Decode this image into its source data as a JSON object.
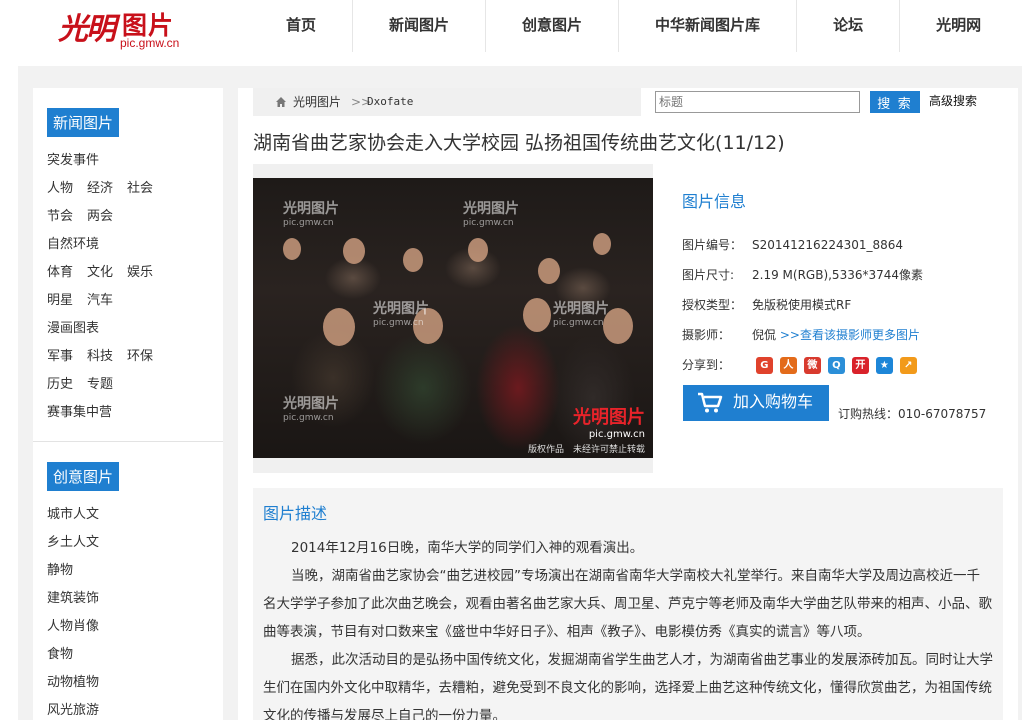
{
  "header": {
    "logo_mark": "光明",
    "logo_text": "图片",
    "logo_url": "pic.gmw.cn",
    "nav": [
      "首页",
      "新闻图片",
      "创意图片",
      "中华新闻图片库",
      "论坛",
      "光明网"
    ]
  },
  "sidebar": {
    "news_title": "新闻图片",
    "news_rows": [
      [
        "突发事件"
      ],
      [
        "人物",
        "经济",
        "社会"
      ],
      [
        "节会",
        "两会"
      ],
      [
        "自然环境"
      ],
      [
        "体育",
        "文化",
        "娱乐"
      ],
      [
        "明星",
        "汽车"
      ],
      [
        "漫画图表"
      ],
      [
        "军事",
        "科技",
        "环保"
      ],
      [
        "历史",
        "专题"
      ],
      [
        "赛事集中营"
      ]
    ],
    "creative_title": "创意图片",
    "creative_rows": [
      [
        "城市人文"
      ],
      [
        "乡土人文"
      ],
      [
        "静物"
      ],
      [
        "建筑装饰"
      ],
      [
        "人物肖像"
      ],
      [
        "食物"
      ],
      [
        "动物植物"
      ],
      [
        "风光旅游"
      ]
    ]
  },
  "breadcrumb": {
    "home": "光明图片",
    "sep": ">>",
    "current": "Dxofate"
  },
  "search": {
    "placeholder": "标题",
    "button": "搜 索",
    "advanced": "高级搜索"
  },
  "title": "湖南省曲艺家协会走入大学校园 弘扬祖国传统曲艺文化(11/12)",
  "photo": {
    "watermark_text": "光明图片",
    "watermark_url": "pic.gmw.cn",
    "footer": "版权作品　未经许可禁止转载"
  },
  "info": {
    "heading": "图片信息",
    "id_label": "图片编号：",
    "id_value": "S20141216224301_8864",
    "size_label": "图片尺寸:",
    "size_value": "2.19 M(RGB),5336*3744像素",
    "license_label": "授权类型：",
    "license_value": "免版税使用模式RF",
    "photographer_label": "摄影师：",
    "photographer_value": "倪侃",
    "photographer_link": ">>查看该摄影师更多图片",
    "share_label": "分享到："
  },
  "share_icons": [
    {
      "name": "google-icon",
      "color": "#e0422c",
      "glyph": "G"
    },
    {
      "name": "renren-icon",
      "color": "#e36b1a",
      "glyph": "人"
    },
    {
      "name": "weibo-icon",
      "color": "#d83a2e",
      "glyph": "微"
    },
    {
      "name": "qzone-icon",
      "color": "#2b8fd8",
      "glyph": "Q"
    },
    {
      "name": "kaixin-icon",
      "color": "#d9222a",
      "glyph": "开"
    },
    {
      "name": "favorite-icon",
      "color": "#1d86d8",
      "glyph": "★"
    },
    {
      "name": "other-share-icon",
      "color": "#f29a1a",
      "glyph": "↗"
    }
  ],
  "cart": {
    "button": "加入购物车",
    "hotline": "订购热线：010-67078757"
  },
  "description": {
    "heading": "图片描述",
    "paragraphs": [
      "2014年12月16日晚，南华大学的同学们入神的观看演出。",
      "当晚，湖南省曲艺家协会“曲艺进校园”专场演出在湖南省南华大学南校大礼堂举行。来自南华大学及周边高校近一千名大学学子参加了此次曲艺晚会，观看由著名曲艺家大兵、周卫星、芦克宁等老师及南华大学曲艺队带来的相声、小品、歌曲等表演，节目有对口数来宝《盛世中华好日子》、相声《教子》、电影模仿秀《真实的谎言》等八项。",
      "据悉，此次活动目的是弘扬中国传统文化，发掘湖南省学生曲艺人才，为湖南省曲艺事业的发展添砖加瓦。同时让大学生们在国内外文化中取精华，去糟粕，避免受到不良文化的影响，选择爱上曲艺这种传统文化，懂得欣赏曲艺，为祖国传统文化的传播与发展尽上自己的一份力量。"
    ]
  }
}
